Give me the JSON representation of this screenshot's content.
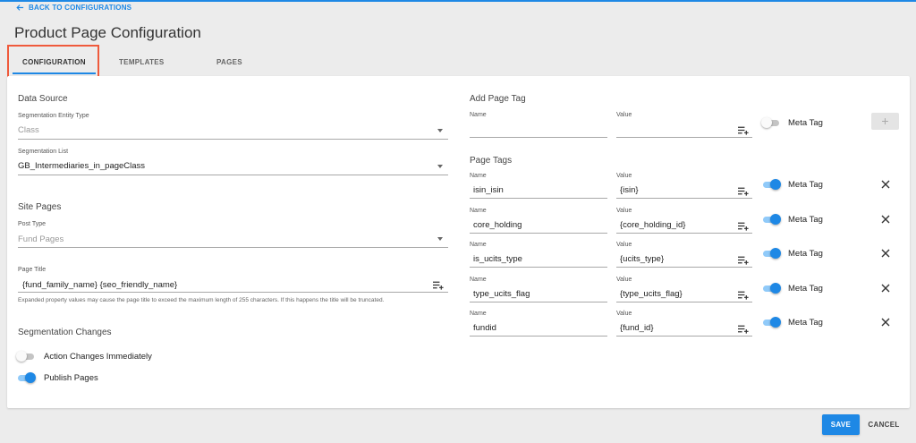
{
  "nav": {
    "back_label": "BACK TO CONFIGURATIONS"
  },
  "page": {
    "title": "Product Page Configuration"
  },
  "tabs": [
    {
      "label": "CONFIGURATION",
      "active": true
    },
    {
      "label": "TEMPLATES",
      "active": false
    },
    {
      "label": "PAGES",
      "active": false
    }
  ],
  "data_source": {
    "heading": "Data Source",
    "entity_type": {
      "label": "Segmentation Entity Type",
      "value": "Class"
    },
    "segmentation_list": {
      "label": "Segmentation List",
      "value": "GB_Intermediaries_in_pageClass"
    }
  },
  "site_pages": {
    "heading": "Site Pages",
    "post_type": {
      "label": "Post Type",
      "value": "Fund Pages"
    },
    "page_title": {
      "label": "Page Title",
      "value": "{fund_family_name} {seo_friendly_name}",
      "hint": "Expanded property values may cause the page title to exceed the maximum length of 255 characters. If this happens the title will be truncated."
    }
  },
  "segmentation_changes": {
    "heading": "Segmentation Changes",
    "action_immediately": {
      "label": "Action Changes Immediately",
      "on": false
    },
    "publish_pages": {
      "label": "Publish Pages",
      "on": true
    }
  },
  "add_page_tag": {
    "heading": "Add Page Tag",
    "name_label": "Name",
    "value_label": "Value",
    "name_value": "",
    "value_value": "",
    "meta_label": "Meta Tag",
    "meta_on": false,
    "add_symbol": "+"
  },
  "page_tags": {
    "heading": "Page Tags",
    "name_label": "Name",
    "value_label": "Value",
    "meta_label": "Meta Tag",
    "items": [
      {
        "name": "isin_isin",
        "value": "{isin}",
        "meta_on": true
      },
      {
        "name": "core_holding",
        "value": "{core_holding_id}",
        "meta_on": true
      },
      {
        "name": "is_ucits_type",
        "value": "{ucits_type}",
        "meta_on": true
      },
      {
        "name": "type_ucits_flag",
        "value": "{type_ucits_flag}",
        "meta_on": true
      },
      {
        "name": "fundid",
        "value": "{fund_id}",
        "meta_on": true
      }
    ]
  },
  "footer": {
    "save_label": "SAVE",
    "cancel_label": "CANCEL"
  },
  "colors": {
    "accent": "#1e88e5",
    "highlight": "#ef5a3c",
    "background": "#ececec"
  }
}
